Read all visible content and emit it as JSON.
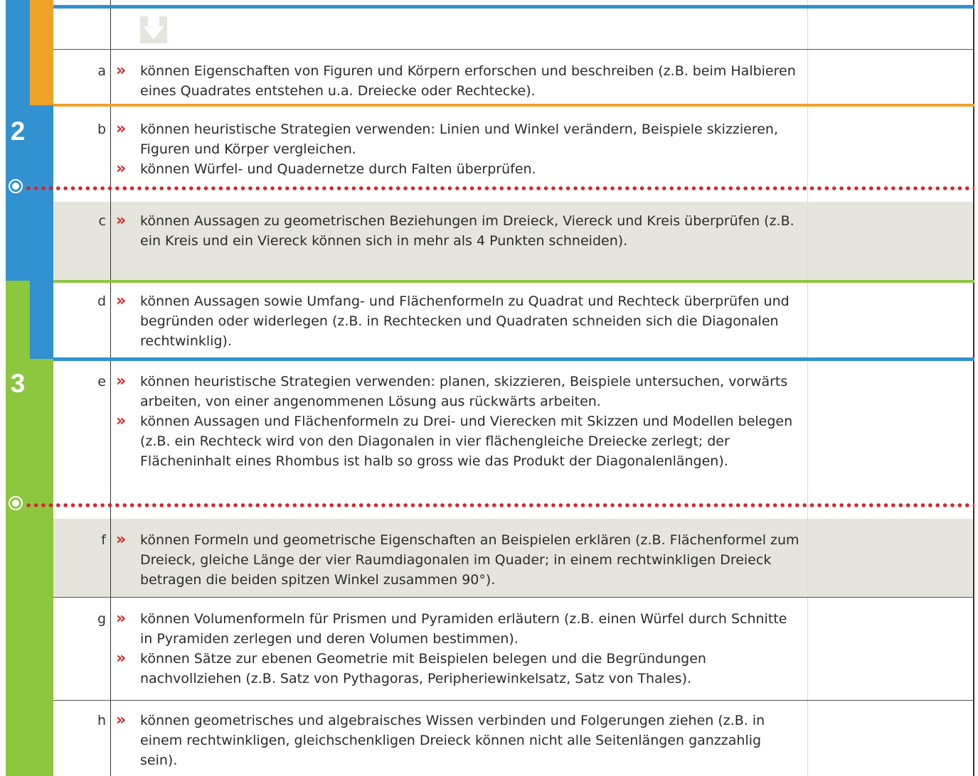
{
  "cycle_labels": {
    "cycle_2": "2",
    "cycle_3": "3"
  },
  "colors": {
    "blue": "#3191d1",
    "orange": "#f0a228",
    "green": "#8dc63f",
    "grey_row": "#e6e5dd",
    "marker_red": "#d7262b"
  },
  "icons": {
    "header": "down-arrow-icon",
    "bullet": "double-chevron-right",
    "minimum_marker": "circle-dot-icon"
  },
  "rows": [
    {
      "letter": "a",
      "bullets": [
        "können Eigenschaften von Figuren und Körpern erforschen und beschreiben (z.B. beim Halbieren eines Quadrates entstehen u.a. Dreiecke oder Rechtecke)."
      ]
    },
    {
      "letter": "b",
      "bullets": [
        "können heuristische Strategien verwenden: Linien und Winkel verändern, Beispiele skizzieren, Figuren und Körper vergleichen.",
        "können Würfel- und Quadernetze durch Falten überprüfen."
      ]
    },
    {
      "letter": "c",
      "bullets": [
        "können Aussagen zu geometrischen Beziehungen im Dreieck, Viereck und Kreis überprüfen (z.B. ein Kreis und ein Viereck können sich in mehr als 4 Punkten schneiden)."
      ]
    },
    {
      "letter": "d",
      "bullets": [
        "können Aussagen sowie Umfang- und Flächenformeln zu Quadrat und Rechteck überprüfen und begründen oder widerlegen (z.B. in Rechtecken und Quadraten schneiden sich die Diagonalen rechtwinklig)."
      ]
    },
    {
      "letter": "e",
      "bullets": [
        "können heuristische Strategien verwenden: planen, skizzieren, Beispiele untersuchen, vorwärts arbeiten, von einer angenommenen Lösung aus rückwärts arbeiten.",
        "können Aussagen und Flächenformeln zu Drei- und Vierecken mit Skizzen und Modellen belegen (z.B. ein Rechteck wird von den Diagonalen in vier flächengleiche Dreiecke zerlegt; der Flächeninhalt eines Rhombus ist halb so gross wie das Produkt der Diagonalenlängen)."
      ]
    },
    {
      "letter": "f",
      "bullets": [
        "können Formeln und geometrische Eigenschaften an Beispielen erklären (z.B. Flächenformel zum Dreieck, gleiche Länge der vier Raumdiagonalen im Quader; in einem rechtwinkligen Dreieck betragen die beiden spitzen Winkel zusammen 90°)."
      ]
    },
    {
      "letter": "g",
      "bullets": [
        "können Volumenformeln für Prismen und Pyramiden erläutern (z.B. einen Würfel durch Schnitte in Pyramiden zerlegen und deren Volumen bestimmen).",
        "können Sätze zur ebenen Geometrie mit Beispielen belegen und die Begründungen nachvollziehen (z.B. Satz von Pythagoras, Peripheriewinkelsatz, Satz von Thales)."
      ]
    },
    {
      "letter": "h",
      "bullets": [
        "können geometrisches und algebraisches Wissen verbinden und Folgerungen ziehen (z.B. in einem rechtwinkligen, gleichschenkligen Dreieck können nicht alle Seitenlängen ganzzahlig sein)."
      ]
    }
  ]
}
